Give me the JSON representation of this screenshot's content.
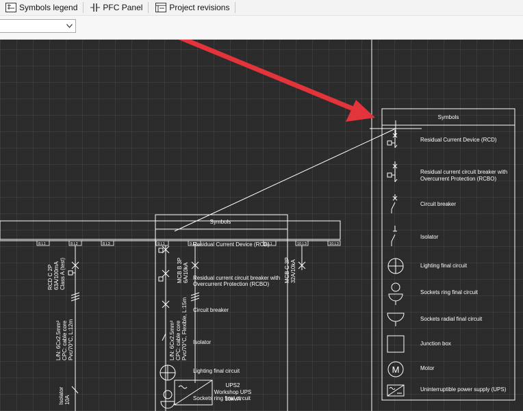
{
  "toolbar": {
    "symbols_legend": "Symbols legend",
    "pfc_panel": "PFC Panel",
    "project_revisions": "Project revisions"
  },
  "legend": {
    "title": "Symbols",
    "items": [
      "Residual Current Device (RCD)",
      "Residual current circuit breaker with",
      "Overcurrent Protection (RCBO)",
      "Circuit breaker",
      "Isolator",
      "Lighting final circuit",
      "Sockets ring final circuit",
      "Sockets radial final circuit",
      "Junction box",
      "Motor",
      "Uninterruptible power supply (UPS)"
    ]
  },
  "small_legend": {
    "title": "Symbols",
    "items": [
      "Residual Current Device (RCD)",
      "Residual current circuit breaker with",
      "Overcurrent Protection (RCBO)",
      "Circuit breaker",
      "Isolator",
      "Lighting final circuit",
      "Sockets ring final circuit"
    ]
  },
  "schematic": {
    "busbar_labels": [
      "8.L1",
      "8.L2",
      "8.L3",
      "9.L1",
      "9.L2",
      "9.L1",
      "10.L3",
      "10.L3"
    ],
    "motor_letter": "M",
    "rcd_rating_1": "RCD C 2P",
    "rcd_rating_2": "63A/100mA",
    "rcd_rating_3": "Class A (test)",
    "mcb_1": "MCB B 3P",
    "mcb_2": "6A/10kA",
    "mcb_3": "MCB C 3P",
    "mcb_4": "32A/10kA",
    "cable_1": "L/N: 6Cx2.5mm²",
    "cable_2": "CPC: cable core",
    "cable_3": "Pvc/70°C, L:12m",
    "cable_4": "L/N: 6Cx2.5mm²",
    "cable_5": "CPC: cable core",
    "cable_6": "Pvc/70°C, Flexible, L:15m",
    "isolator_1": "Isolator",
    "isolator_2": "10A",
    "ups_title": "UPS2",
    "ups_sub": "Workshop UPS",
    "ups_rating": "10kVA"
  },
  "colors": {
    "arrow": "#e3333b",
    "canvas": "#2b2b2b",
    "lines": "#ffffff"
  }
}
